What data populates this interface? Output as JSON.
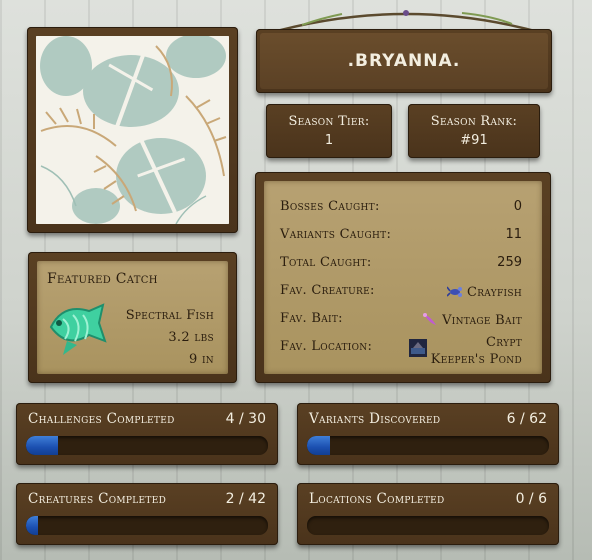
{
  "player": {
    "name": ".BRYANNA."
  },
  "season": {
    "tier_label": "Season Tier:",
    "tier_value": "1",
    "rank_label": "Season Rank:",
    "rank_value": "#91"
  },
  "stats": [
    {
      "label": "Bosses Caught:",
      "value": "0"
    },
    {
      "label": "Variants Caught:",
      "value": "11"
    },
    {
      "label": "Total Caught:",
      "value": "259"
    },
    {
      "label": "Fav. Creature:",
      "value": "Crayfish",
      "icon": "crayfish-icon"
    },
    {
      "label": "Fav. Bait:",
      "value": "Vintage Bait",
      "icon": "vintage-bait-icon"
    },
    {
      "label": "Fav. Location:",
      "value_line1": "Crypt",
      "value_line2": "Keeper's Pond",
      "icon": "crypt-keepers-pond-icon"
    }
  ],
  "featured": {
    "title": "Featured Catch",
    "name": "Spectral Fish",
    "weight": "3.2 lbs",
    "length": "9 in",
    "icon": "spectral-fish-icon",
    "color": "#3fd0a0"
  },
  "progress": [
    {
      "label": "Challenges Completed",
      "count": "4 / 30",
      "current": 4,
      "total": 30
    },
    {
      "label": "Variants Discovered",
      "count": "6 / 62",
      "current": 6,
      "total": 62
    },
    {
      "label": "Creatures Completed",
      "count": "2 / 42",
      "current": 2,
      "total": 42
    },
    {
      "label": "Locations Completed",
      "count": "0 / 6",
      "current": 0,
      "total": 6
    }
  ],
  "colors": {
    "wood": "#4f371e",
    "panel": "#b09a68",
    "progress_fill": "#2a62c8",
    "text_light": "#f3eee0",
    "text_dark": "#2a1d0e"
  }
}
